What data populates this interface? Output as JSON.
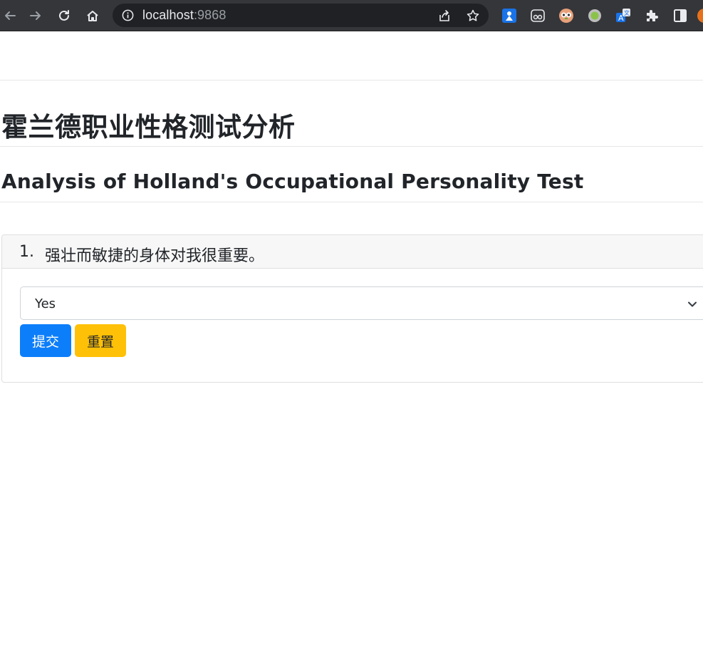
{
  "browser": {
    "url_host": "localhost",
    "url_port": ":9868",
    "icons": [
      "back-icon",
      "forward-icon",
      "reload-icon",
      "home-icon",
      "site-info-icon",
      "share-icon",
      "bookmark-star-icon",
      "extension-translate-icon",
      "extension-reader-icon",
      "extension-owl-icon",
      "extension-circle-icon",
      "extension-language-icon",
      "extensions-puzzle-icon",
      "side-panel-icon",
      "profile-avatar-icon"
    ]
  },
  "page": {
    "title_zh": "霍兰德职业性格测试分析",
    "title_en": "Analysis of Holland's Occupational Personality Test"
  },
  "question": {
    "number": "1.",
    "text": "强壮而敏捷的身体对我很重要。",
    "selected_option": "Yes"
  },
  "actions": {
    "submit_label": "提交",
    "reset_label": "重置"
  },
  "colors": {
    "submit": "#0d7efa",
    "reset": "#ffc107",
    "chrome": "#35363a"
  }
}
